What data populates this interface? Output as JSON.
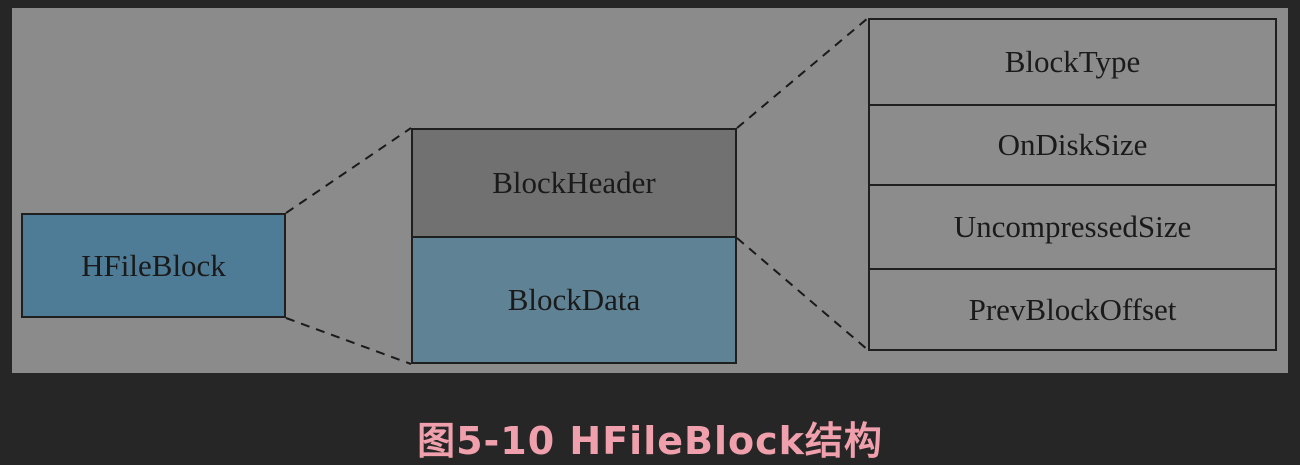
{
  "diagram": {
    "root_block": "HFileBlock",
    "block_parts": {
      "header": "BlockHeader",
      "data": "BlockData"
    },
    "header_fields": [
      "BlockType",
      "OnDiskSize",
      "UncompressedSize",
      "PrevBlockOffset"
    ]
  },
  "caption": "图5-10 HFileBlock结构",
  "colors": {
    "page_background": "#262626",
    "panel_background": "#8b8b8b",
    "root_block_fill": "#4e7b95",
    "header_fill": "#717171",
    "data_fill": "#5f8294",
    "caption_color": "#f0a0ac"
  }
}
